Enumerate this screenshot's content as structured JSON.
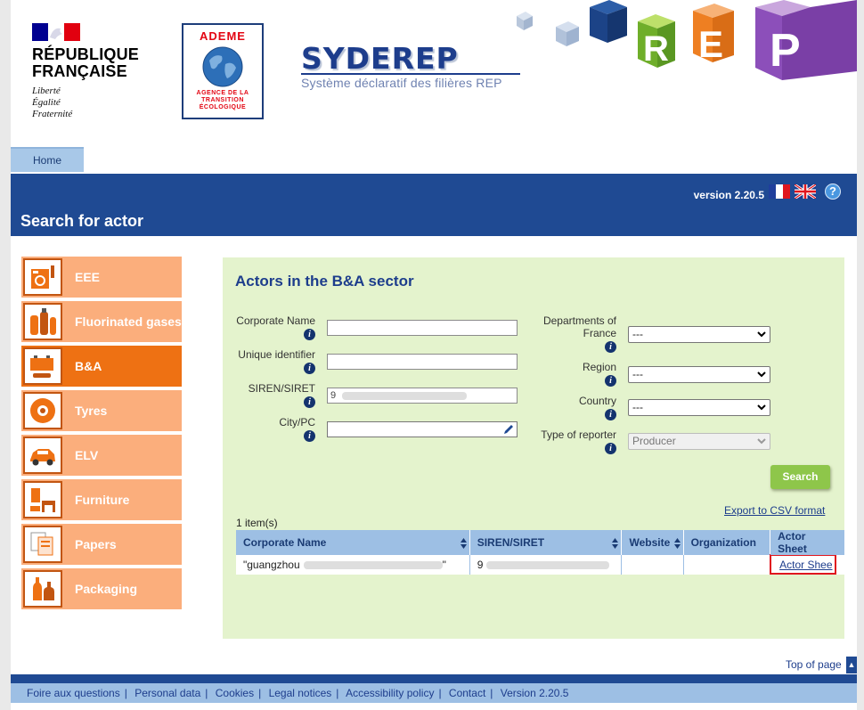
{
  "header": {
    "republic_title_line1": "RÉPUBLIQUE",
    "republic_title_line2": "FRANÇAISE",
    "motto": [
      "Liberté",
      "Égalité",
      "Fraternité"
    ],
    "ademe_name": "ADEME",
    "ademe_sub": [
      "AGENCE DE LA",
      "TRANSITION",
      "ÉCOLOGIQUE"
    ],
    "app_title": "SYDEREP",
    "app_subtitle": "Système déclaratif des filières REP",
    "cube_letters": [
      "R",
      "E",
      "P"
    ]
  },
  "nav": {
    "home": "Home"
  },
  "banner": {
    "version": "version 2.20.5",
    "help": "?",
    "page_title": "Search for actor"
  },
  "sidebar": {
    "items": [
      {
        "label": "EEE",
        "icon": "appliances-icon",
        "active": false
      },
      {
        "label": "Fluorinated gases",
        "icon": "gas-cylinders-icon",
        "active": false
      },
      {
        "label": "B&A",
        "icon": "batteries-icon",
        "active": true
      },
      {
        "label": "Tyres",
        "icon": "tyre-icon",
        "active": false
      },
      {
        "label": "ELV",
        "icon": "car-icon",
        "active": false
      },
      {
        "label": "Furniture",
        "icon": "furniture-icon",
        "active": false
      },
      {
        "label": "Papers",
        "icon": "papers-icon",
        "active": false
      },
      {
        "label": "Packaging",
        "icon": "bottles-icon",
        "active": false
      }
    ]
  },
  "search": {
    "title": "Actors in the B&A sector",
    "corporate_name_label": "Corporate Name",
    "corporate_name_value": "",
    "unique_identifier_label": "Unique identifier",
    "unique_identifier_value": "",
    "siren_label": "SIREN/SIRET",
    "siren_value": "9",
    "city_label": "City/PC",
    "city_value": "",
    "departments_label_line1": "Departments of",
    "departments_label_line2": "France",
    "departments_value": "---",
    "region_label": "Region",
    "region_value": "---",
    "country_label": "Country",
    "country_value": "---",
    "reporter_label": "Type of reporter",
    "reporter_value": "Producer",
    "search_button": "Search",
    "info": "i"
  },
  "results": {
    "export_link": "Export to CSV format",
    "count": "1 item(s)",
    "columns": [
      "Corporate Name",
      "SIREN/SIRET",
      "Website",
      "Organization",
      "Actor Sheet"
    ],
    "rows": [
      {
        "corporate_name": "\"guangzhou",
        "corporate_name_end": "\"",
        "siren": "9",
        "website": "",
        "organization": "",
        "actor_sheet": "Actor Shee"
      }
    ]
  },
  "footer": {
    "top_of_page": "Top of page",
    "links": [
      "Foire aux questions",
      "Personal data",
      "Cookies",
      "Legal notices",
      "Accessibility policy",
      "Contact",
      "Version 2.20.5"
    ]
  },
  "colors": {
    "brand_blue": "#1f4a93",
    "sidebar_orange": "#fbae7c",
    "sidebar_active": "#ee7113",
    "panel_green": "#e4f3cd",
    "button_green": "#8ec64a",
    "table_header": "#9dbfe4",
    "highlight_red": "#e0161e"
  }
}
